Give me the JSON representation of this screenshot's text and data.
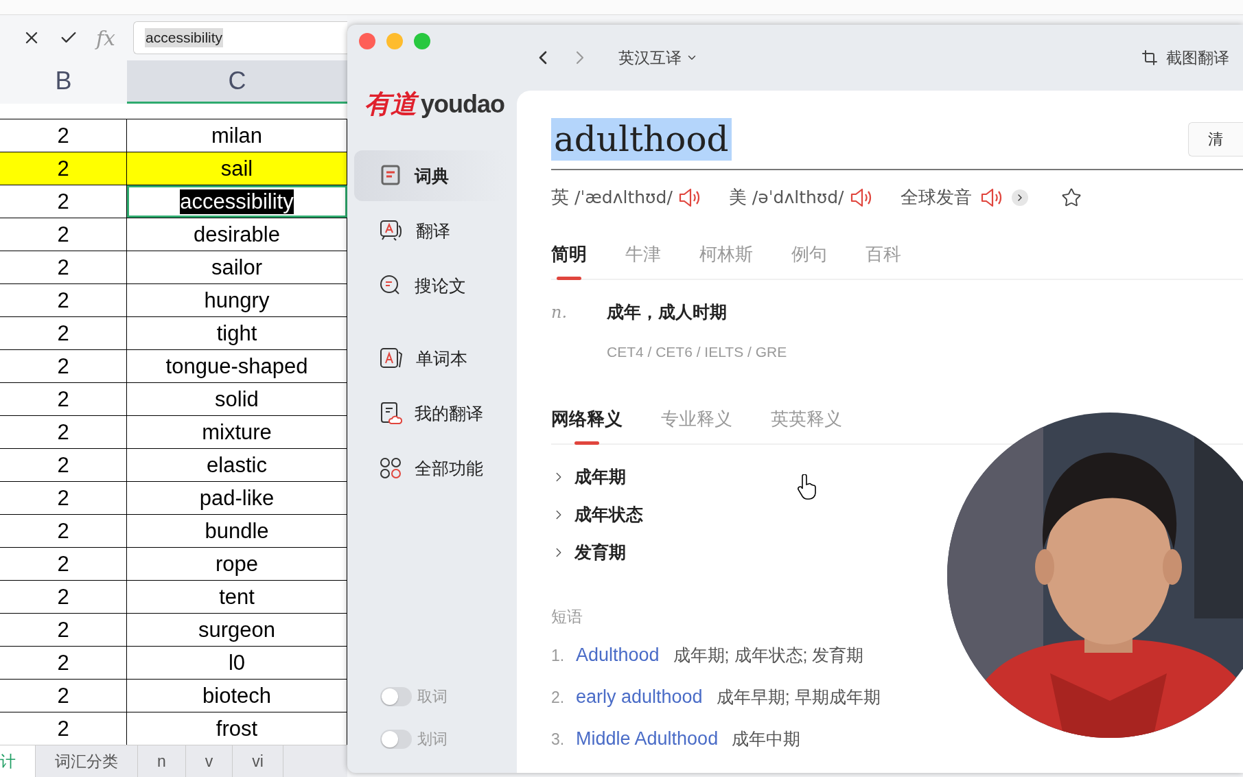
{
  "spreadsheet": {
    "formula_bar": {
      "fx": "fx",
      "value": "accessibility"
    },
    "columns": [
      "B",
      "C"
    ],
    "rows": [
      {
        "b": "2",
        "c": "milan",
        "highlighted": false,
        "active": false
      },
      {
        "b": "2",
        "c": "sail",
        "highlighted": true,
        "active": false
      },
      {
        "b": "2",
        "c": "accessibility",
        "highlighted": false,
        "active": true
      },
      {
        "b": "2",
        "c": "desirable",
        "highlighted": false,
        "active": false
      },
      {
        "b": "2",
        "c": "sailor",
        "highlighted": false,
        "active": false
      },
      {
        "b": "2",
        "c": "hungry",
        "highlighted": false,
        "active": false
      },
      {
        "b": "2",
        "c": "tight",
        "highlighted": false,
        "active": false
      },
      {
        "b": "2",
        "c": "tongue-shaped",
        "highlighted": false,
        "active": false
      },
      {
        "b": "2",
        "c": "solid",
        "highlighted": false,
        "active": false
      },
      {
        "b": "2",
        "c": "mixture",
        "highlighted": false,
        "active": false
      },
      {
        "b": "2",
        "c": "elastic",
        "highlighted": false,
        "active": false
      },
      {
        "b": "2",
        "c": "pad-like",
        "highlighted": false,
        "active": false
      },
      {
        "b": "2",
        "c": "bundle",
        "highlighted": false,
        "active": false
      },
      {
        "b": "2",
        "c": "rope",
        "highlighted": false,
        "active": false
      },
      {
        "b": "2",
        "c": "tent",
        "highlighted": false,
        "active": false
      },
      {
        "b": "2",
        "c": "surgeon",
        "highlighted": false,
        "active": false
      },
      {
        "b": "2",
        "c": "l0",
        "highlighted": false,
        "active": false
      },
      {
        "b": "2",
        "c": "biotech",
        "highlighted": false,
        "active": false
      },
      {
        "b": "2",
        "c": "frost",
        "highlighted": false,
        "active": false
      }
    ],
    "sheet_tabs": [
      {
        "label": "计",
        "selected": true
      },
      {
        "label": "词汇分类",
        "selected": false
      },
      {
        "label": "n",
        "selected": false
      },
      {
        "label": "v",
        "selected": false
      },
      {
        "label": "vi",
        "selected": false
      }
    ]
  },
  "dictionary": {
    "toolbar": {
      "mode": "英汉互译",
      "screenshot_translate": "截图翻译"
    },
    "logo": {
      "cn": "有道",
      "en": "youdao"
    },
    "sidebar": {
      "items": [
        {
          "label": "词典",
          "kind": "book",
          "selected": true
        },
        {
          "label": "翻译",
          "kind": "chat",
          "selected": false
        },
        {
          "label": "搜论文",
          "kind": "search",
          "selected": false
        },
        {
          "label": "单词本",
          "kind": "cards",
          "selected": false
        },
        {
          "label": "我的翻译",
          "kind": "cloud",
          "selected": false
        },
        {
          "label": "全部功能",
          "kind": "grid",
          "selected": false
        }
      ],
      "toggles": [
        {
          "label": "取词",
          "on": false
        },
        {
          "label": "划词",
          "on": false
        }
      ]
    },
    "word": "adulthood",
    "clear_button": "清",
    "pronunciations": [
      {
        "region": "英",
        "ipa": "/ˈædʌlthʊd/"
      },
      {
        "region": "美",
        "ipa": "/əˈdʌlthʊd/"
      }
    ],
    "global_pronunciation": "全球发音",
    "tabs": [
      {
        "label": "简明",
        "selected": true
      },
      {
        "label": "牛津",
        "selected": false
      },
      {
        "label": "柯林斯",
        "selected": false
      },
      {
        "label": "例句",
        "selected": false
      },
      {
        "label": "百科",
        "selected": false
      }
    ],
    "definition": {
      "pos": "n.",
      "meaning": "成年，成人时期"
    },
    "exam_tags": "CET4 / CET6 / IELTS / GRE",
    "web_tabs": [
      {
        "label": "网络释义",
        "selected": true
      },
      {
        "label": "专业释义",
        "selected": false
      },
      {
        "label": "英英释义",
        "selected": false
      }
    ],
    "web_meanings": [
      "成年期",
      "成年状态",
      "发育期"
    ],
    "phrases_title": "短语",
    "phrases": [
      {
        "num": "1.",
        "term": "Adulthood",
        "meaning": "成年期; 成年状态; 发育期"
      },
      {
        "num": "2.",
        "term": "early adulthood",
        "meaning": "成年早期; 早期成年期"
      },
      {
        "num": "3.",
        "term": "Middle Adulthood",
        "meaning": "成年中期"
      }
    ]
  }
}
